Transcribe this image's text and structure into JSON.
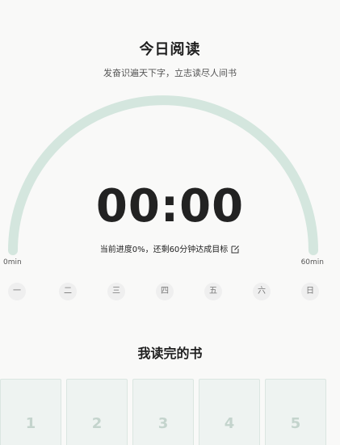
{
  "header": {
    "title": "今日阅读",
    "subtitle": "发奋识遍天下字，立志读尽人间书"
  },
  "timer": {
    "value": "00:00",
    "progress_text": "当前进度0%，还剩60分钟达成目标",
    "progress_fraction": 0,
    "min_label": "0min",
    "max_label": "60min",
    "edit_icon": "edit-icon"
  },
  "colors": {
    "arc_track": "#d4e6de",
    "background": "#f9f9f8",
    "weekday_bg": "#efefef",
    "book_bg": "#eef3f1",
    "book_number": "#c4d4cd"
  },
  "weekdays": [
    "一",
    "二",
    "三",
    "四",
    "五",
    "六",
    "日"
  ],
  "finished_books": {
    "title": "我读完的书",
    "items": [
      "1",
      "2",
      "3",
      "4",
      "5"
    ]
  }
}
